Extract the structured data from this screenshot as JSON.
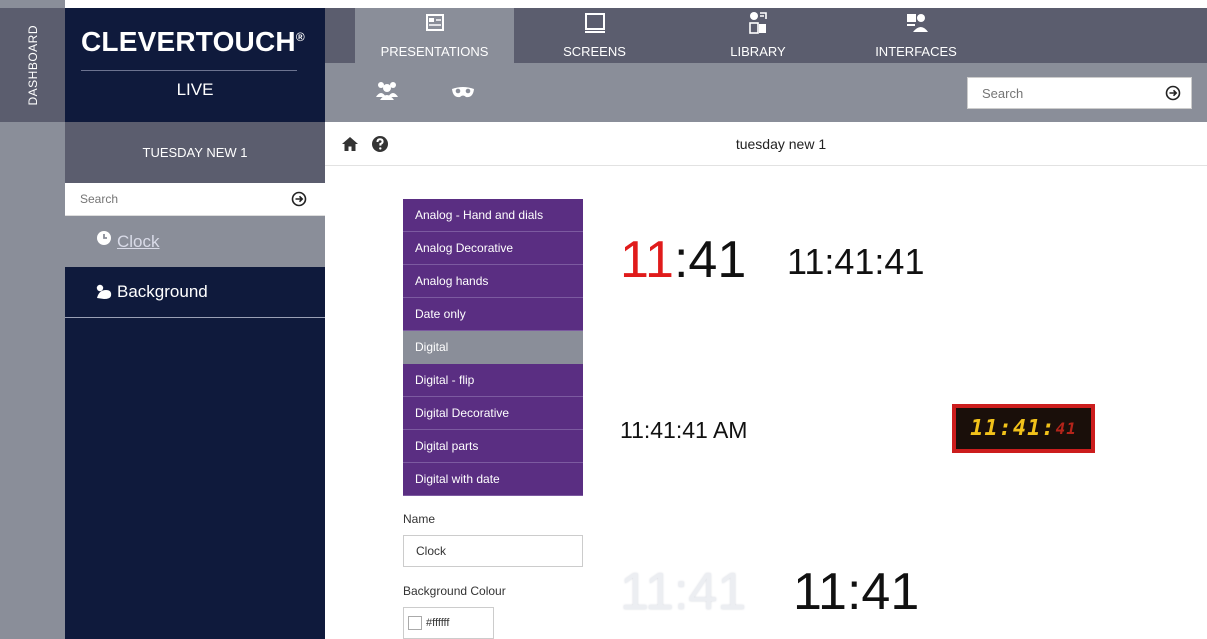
{
  "dashboard_tab": "DASHBOARD",
  "logo": {
    "brand": "CLEVERTOUCH",
    "registered": "®",
    "sub": "LIVE"
  },
  "top_tabs": [
    {
      "label": "PRESENTATIONS",
      "icon": "presentations-icon",
      "active": true
    },
    {
      "label": "SCREENS",
      "icon": "screen-icon",
      "active": false
    },
    {
      "label": "LIBRARY",
      "icon": "library-icon",
      "active": false
    },
    {
      "label": "INTERFACES",
      "icon": "interfaces-icon",
      "active": false
    }
  ],
  "sub_bar": {
    "icons": [
      "users-icon",
      "mask-icon"
    ],
    "search_placeholder": "Search"
  },
  "left_panel": {
    "title": "TUESDAY NEW 1",
    "search_placeholder": "Search",
    "items": [
      {
        "label": "Clock",
        "icon": "clock-icon",
        "active": true
      },
      {
        "label": "Background",
        "icon": "background-icon",
        "active": false
      }
    ]
  },
  "content": {
    "title": "tuesday new 1"
  },
  "clock_styles": [
    "Analog - Hand and dials",
    "Analog Decorative",
    "Analog hands",
    "Date only",
    "Digital",
    "Digital - flip",
    "Digital Decorative",
    "Digital parts",
    "Digital with date"
  ],
  "selected_style": "Digital",
  "form": {
    "name_label": "Name",
    "name_value": "Clock",
    "bg_label": "Background Colour",
    "bg_value": "#ffffff"
  },
  "previews": {
    "p1_hour": "11",
    "p1_rest": ":41",
    "p2": "11:41:41",
    "p3": "11:41:41 AM",
    "p4_hm": "11:41:",
    "p4_sec": "41",
    "p5": "11:41",
    "p6": "11:41"
  },
  "colors": {
    "nav_dark": "#0f1a3c",
    "nav_mid": "#5b5d6e",
    "nav_light": "#8a8e99",
    "purple": "#5a2e82",
    "red": "#e01b1b"
  }
}
